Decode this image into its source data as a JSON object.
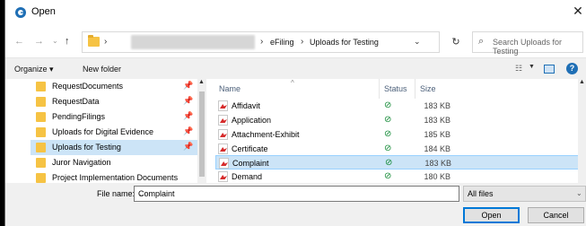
{
  "window": {
    "title": "Open",
    "close_glyph": "✕"
  },
  "nav": {
    "back": "←",
    "forward": "→",
    "dropdown": "⌄",
    "up": "↑"
  },
  "address": {
    "crumbs": [
      "eFiling",
      "Uploads for Testing"
    ],
    "separator": "›",
    "dropdown": "⌄",
    "refresh": "↻"
  },
  "search": {
    "placeholder": "Search Uploads for Testing",
    "icon": "⌕"
  },
  "toolbar": {
    "organize": "Organize ▾",
    "new_folder": "New folder"
  },
  "sidebar": {
    "items": [
      {
        "label": "RequestDocuments",
        "pinned": true
      },
      {
        "label": "RequestData",
        "pinned": true
      },
      {
        "label": "PendingFilings",
        "pinned": true
      },
      {
        "label": "Uploads for Digital Evidence",
        "pinned": true
      },
      {
        "label": "Uploads for Testing",
        "pinned": true,
        "selected": true
      },
      {
        "label": "Juror Navigation",
        "pinned": false
      },
      {
        "label": "Project Implementation Documents",
        "pinned": false
      }
    ],
    "pin_glyph": "📌"
  },
  "columns": {
    "name": "Name",
    "status": "Status",
    "size": "Size"
  },
  "files": [
    {
      "name": "Affidavit",
      "status": "⊘",
      "size": "183 KB"
    },
    {
      "name": "Application",
      "status": "⊘",
      "size": "183 KB"
    },
    {
      "name": "Attachment-Exhibit",
      "status": "⊘",
      "size": "185 KB"
    },
    {
      "name": "Certificate",
      "status": "⊘",
      "size": "184 KB"
    },
    {
      "name": "Complaint",
      "status": "⊘",
      "size": "183 KB",
      "selected": true
    },
    {
      "name": "Demand",
      "status": "⊘",
      "size": "180 KB"
    }
  ],
  "bottom": {
    "file_name_label": "File name:",
    "file_name_value": "Complaint",
    "filter": "All files",
    "open": "Open",
    "cancel": "Cancel"
  },
  "colors": {
    "accent": "#0078d7",
    "selection": "#cce4f7",
    "status_ok": "#138a36",
    "folder": "#f6c344",
    "pdf": "#d62b2b"
  }
}
